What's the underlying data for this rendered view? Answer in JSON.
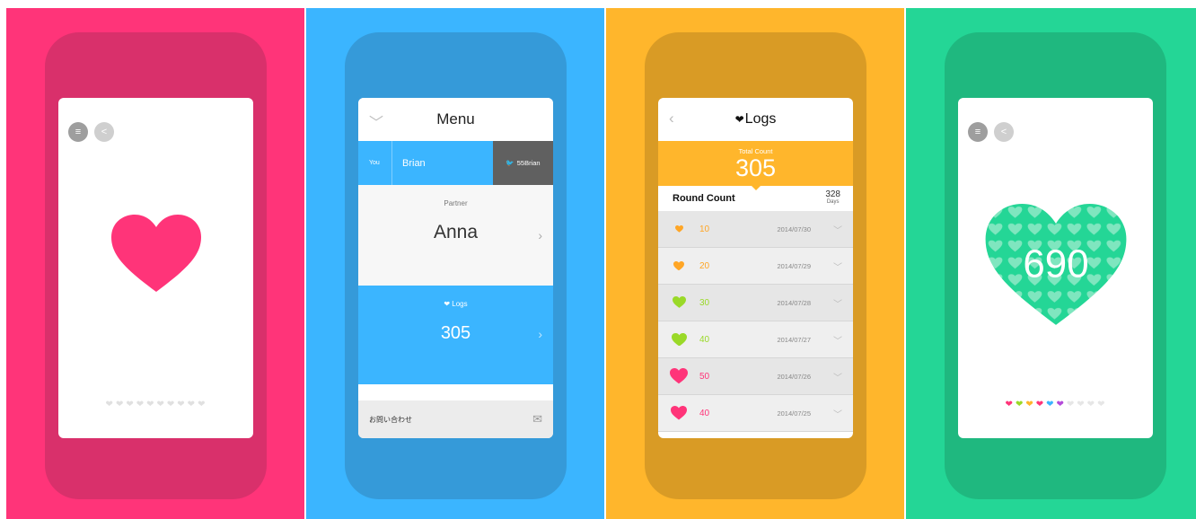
{
  "panels": [
    {
      "id": "heart-screen",
      "colors": {
        "bg": "#ff3479",
        "phone": "#d9306b",
        "heart": "#ff3479"
      },
      "buttons": [
        {
          "icon": "menu-icon"
        },
        {
          "icon": "share-icon"
        }
      ],
      "heart_progress": {
        "filled": 0,
        "total": 10
      }
    },
    {
      "id": "menu-screen",
      "header": {
        "title": "Menu",
        "left_icon": "chevron-down-icon"
      },
      "user": {
        "you_label": "You",
        "name": "Brian",
        "twitter": "55Brian"
      },
      "partner": {
        "label": "Partner",
        "name": "Anna"
      },
      "logs": {
        "label": "Logs",
        "count": "305"
      },
      "contact": {
        "label": "お問い合わせ",
        "icon": "mail-icon"
      }
    },
    {
      "id": "logs-screen",
      "header": {
        "title": "Logs"
      },
      "total": {
        "label": "Total Count",
        "value": "305"
      },
      "round": {
        "label": "Round Count",
        "days_value": "328",
        "days_unit": "Days"
      },
      "rows": [
        {
          "count": "10",
          "date": "2014/07/30",
          "color": "#ffa626"
        },
        {
          "count": "20",
          "date": "2014/07/29",
          "color": "#ffa626"
        },
        {
          "count": "30",
          "date": "2014/07/28",
          "color": "#9ad928"
        },
        {
          "count": "40",
          "date": "2014/07/27",
          "color": "#9ad928"
        },
        {
          "count": "50",
          "date": "2014/07/26",
          "color": "#ff3479"
        },
        {
          "count": "40",
          "date": "2014/07/25",
          "color": "#ff3479"
        }
      ]
    },
    {
      "id": "count-screen",
      "count": "690",
      "colors": {
        "heart": "#24d696"
      },
      "color_hearts": [
        "#ff3479",
        "#9ad928",
        "#ffb62c",
        "#ff3479",
        "#3bb5ff",
        "#b44bd9"
      ]
    }
  ]
}
